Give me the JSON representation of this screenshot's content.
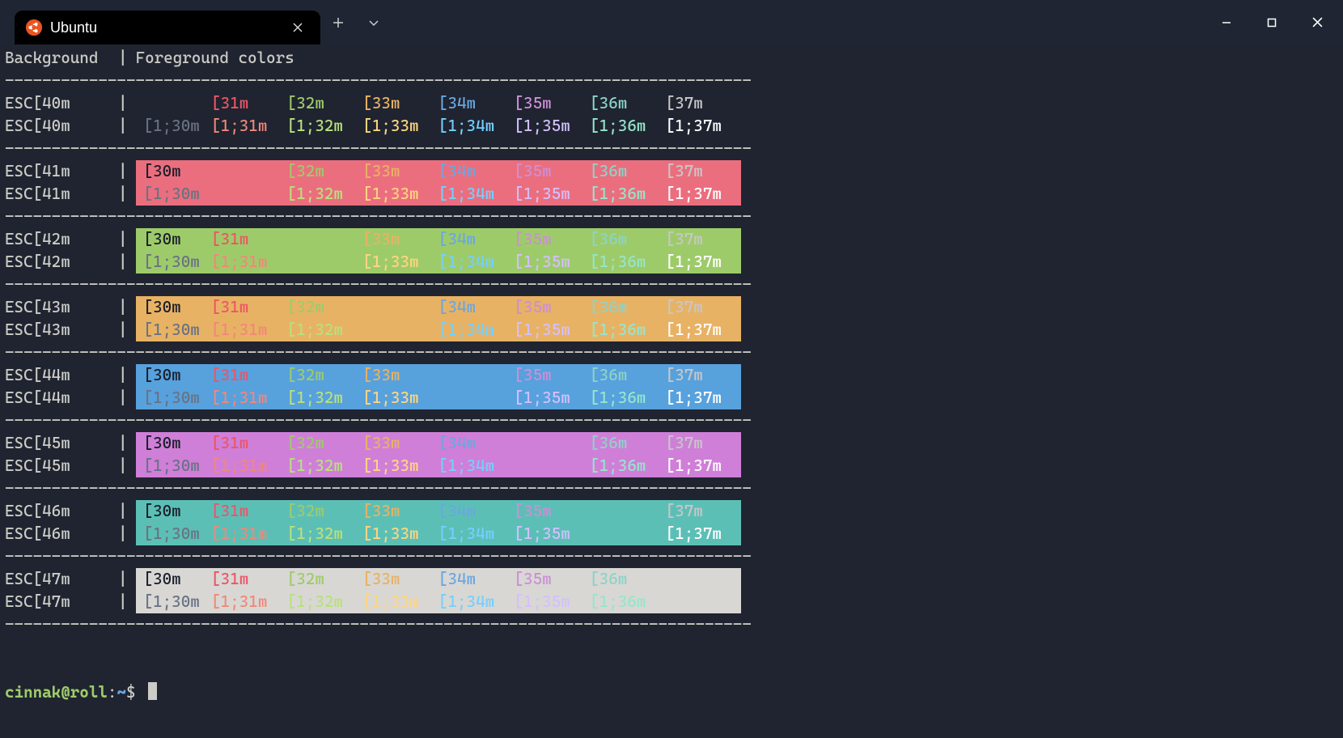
{
  "tab": {
    "title": "Ubuntu"
  },
  "header": {
    "bg": "Background",
    "fg": "Foreground colors",
    "sep": "|"
  },
  "divider": "--------------------------------------------------------------------------------",
  "pipe": "|",
  "prompt": {
    "user_host": "cinnak@roll",
    "colon": ":",
    "path": "~",
    "dollar": "$ "
  },
  "palette": {
    "fg": {
      "30": "#191e2a",
      "31": "#ed5566",
      "32": "#9ecb6a",
      "33": "#e8b264",
      "34": "#6aa7e0",
      "35": "#cc8fd6",
      "36": "#8dd3c6",
      "37": "#c7c7c7"
    },
    "fg_bold": {
      "30": "#697283",
      "31": "#f28779",
      "32": "#b9e07e",
      "33": "#ffd580",
      "34": "#73d0ff",
      "35": "#d4bfff",
      "36": "#95e6cb",
      "37": "#ffffff"
    },
    "bg": {
      "40": "#1f2430",
      "41": "#eb6e7e",
      "42": "#9ecb6a",
      "43": "#e8b264",
      "44": "#57a1dd",
      "45": "#cf7fd8",
      "46": "#5cbfb6",
      "47": "#d8d7d4"
    }
  },
  "fgCodes": [
    "30",
    "31",
    "32",
    "33",
    "34",
    "35",
    "36",
    "37"
  ],
  "bgCodes": [
    "40",
    "41",
    "42",
    "43",
    "44",
    "45",
    "46",
    "47"
  ],
  "groups": [
    {
      "bg": "40",
      "rows": [
        {
          "label": "ESC[40m",
          "bold": false,
          "cells": [
            "",
            "[31m",
            "[32m",
            "[33m",
            "[34m",
            "[35m",
            "[36m",
            "[37m"
          ]
        },
        {
          "label": "ESC[40m",
          "bold": true,
          "cells": [
            "[1;30m",
            "[1;31m",
            "[1;32m",
            "[1;33m",
            "[1;34m",
            "[1;35m",
            "[1;36m",
            "[1;37m"
          ]
        }
      ]
    },
    {
      "bg": "41",
      "rows": [
        {
          "label": "ESC[41m",
          "bold": false,
          "cells": [
            "[30m",
            "",
            "[32m",
            "[33m",
            "[34m",
            "[35m",
            "[36m",
            "[37m"
          ]
        },
        {
          "label": "ESC[41m",
          "bold": true,
          "cells": [
            "[1;30m",
            "",
            "[1;32m",
            "[1;33m",
            "[1;34m",
            "[1;35m",
            "[1;36m",
            "[1;37m"
          ]
        }
      ]
    },
    {
      "bg": "42",
      "rows": [
        {
          "label": "ESC[42m",
          "bold": false,
          "cells": [
            "[30m",
            "[31m",
            "",
            "[33m",
            "[34m",
            "[35m",
            "[36m",
            "[37m"
          ]
        },
        {
          "label": "ESC[42m",
          "bold": true,
          "cells": [
            "[1;30m",
            "[1;31m",
            "",
            "[1;33m",
            "[1;34m",
            "[1;35m",
            "[1;36m",
            "[1;37m"
          ]
        }
      ]
    },
    {
      "bg": "43",
      "rows": [
        {
          "label": "ESC[43m",
          "bold": false,
          "cells": [
            "[30m",
            "[31m",
            "[32m",
            "",
            "[34m",
            "[35m",
            "[36m",
            "[37m"
          ]
        },
        {
          "label": "ESC[43m",
          "bold": true,
          "cells": [
            "[1;30m",
            "[1;31m",
            "[1;32m",
            "",
            "[1;34m",
            "[1;35m",
            "[1;36m",
            "[1;37m"
          ]
        }
      ]
    },
    {
      "bg": "44",
      "rows": [
        {
          "label": "ESC[44m",
          "bold": false,
          "cells": [
            "[30m",
            "[31m",
            "[32m",
            "[33m",
            "",
            "[35m",
            "[36m",
            "[37m"
          ]
        },
        {
          "label": "ESC[44m",
          "bold": true,
          "cells": [
            "[1;30m",
            "[1;31m",
            "[1;32m",
            "[1;33m",
            "",
            "[1;35m",
            "[1;36m",
            "[1;37m"
          ]
        }
      ]
    },
    {
      "bg": "45",
      "rows": [
        {
          "label": "ESC[45m",
          "bold": false,
          "cells": [
            "[30m",
            "[31m",
            "[32m",
            "[33m",
            "[34m",
            "",
            "[36m",
            "[37m"
          ]
        },
        {
          "label": "ESC[45m",
          "bold": true,
          "cells": [
            "[1;30m",
            "[1;31m",
            "[1;32m",
            "[1;33m",
            "[1;34m",
            "",
            "[1;36m",
            "[1;37m"
          ]
        }
      ]
    },
    {
      "bg": "46",
      "rows": [
        {
          "label": "ESC[46m",
          "bold": false,
          "cells": [
            "[30m",
            "[31m",
            "[32m",
            "[33m",
            "[34m",
            "[35m",
            "",
            "[37m"
          ]
        },
        {
          "label": "ESC[46m",
          "bold": true,
          "cells": [
            "[1;30m",
            "[1;31m",
            "[1;32m",
            "[1;33m",
            "[1;34m",
            "[1;35m",
            "",
            "[1;37m"
          ]
        }
      ]
    },
    {
      "bg": "47",
      "rows": [
        {
          "label": "ESC[47m",
          "bold": false,
          "cells": [
            "[30m",
            "[31m",
            "[32m",
            "[33m",
            "[34m",
            "[35m",
            "[36m",
            ""
          ]
        },
        {
          "label": "ESC[47m",
          "bold": true,
          "cells": [
            "[1;30m",
            "[1;31m",
            "[1;32m",
            "[1;33m",
            "[1;34m",
            "[1;35m",
            "[1;36m",
            ""
          ]
        }
      ]
    }
  ]
}
